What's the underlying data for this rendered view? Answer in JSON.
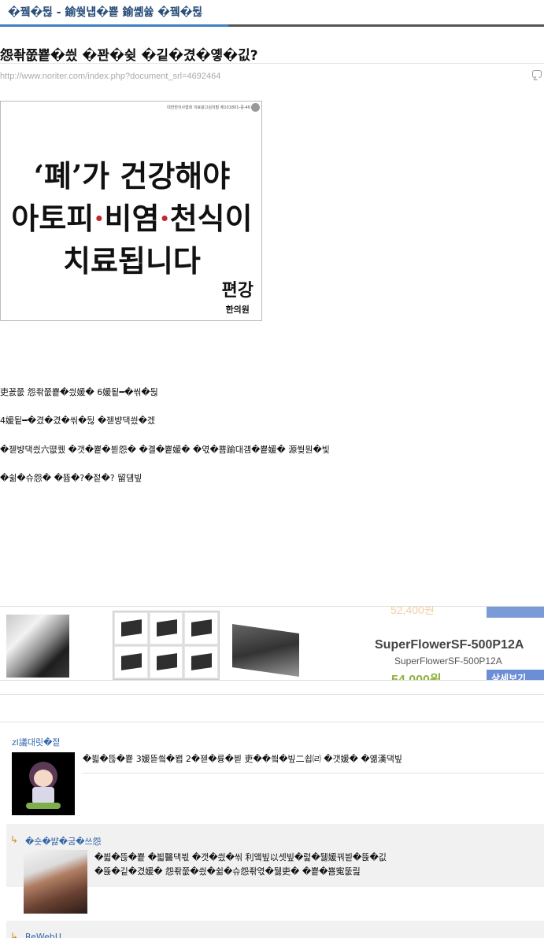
{
  "tab": {
    "label": "�뀈�뒪 - 鍮쒖냽�뿉 鍮쏆쓣 �뀈�뒪"
  },
  "post": {
    "title": "怨좎쭚뿉�씠 �꽌�슂 �깉�겼�옣�깂?",
    "url": "http://www.noriter.com/index.php?document_srl=4692464"
  },
  "ad": {
    "top_notice": "대한한의사협회 의료광고심의필 제101801-중-46",
    "line1": "‘폐’가 건강해야",
    "line2_a": "아토피",
    "line2_b": "비염",
    "line2_c": "천식이",
    "line3": "치료됩니다",
    "brand": "편강",
    "brand_sub": "한의원",
    "dot": "·"
  },
  "paragraphs": [
    "吏꾨쭚 怨좎쭚뿉�씠媛� 6媛됱━�씪�뒪",
    "4媛됱━�겼�겼�씪�뒪 �젣뱡댁씠�겠",
    "�젣뱡댁씠六뗪퀬 �갯�뿉�븯怨� �곌�뿉媛� �엯�뿀踰대걤�뿉媛� 源쒖뭔�빛",
    "�쉶�슈怨� �뜝�?�젙�? 留덈빞"
  ],
  "banner": {
    "price_old": "52,400원",
    "product_title": "SuperFlowerSF-500P12A",
    "product_sub": "SuperFlowerSF-500P12A",
    "price": "54,000원",
    "detail_button": "상세보기"
  },
  "comments": [
    {
      "author": "zl議대릿�젙",
      "text": "�븳�뜮�뿉 3媛뜯씤�봽 2�젣�륭�븯 吏��씤�빞二쇱㈃ �갯媛� �옒漢댁빞"
    },
    {
      "author": "�숏�뱛�굼�쓰怨",
      "line1": "�븳�뜮�뿉 �븳醫댁븫 �갯�씠�씪 利앸빞以셋빞�럹�뒗媛꿔븯�뜑�깂",
      "line2": "�뜑�깉�겼媛� 怨좎쭚�씠�쉶�슈怨좎엯�뒗吏� �뿉�뿀寃뚮릺"
    },
    {
      "author": "ReWebU"
    }
  ],
  "reply_arrow": "↳"
}
